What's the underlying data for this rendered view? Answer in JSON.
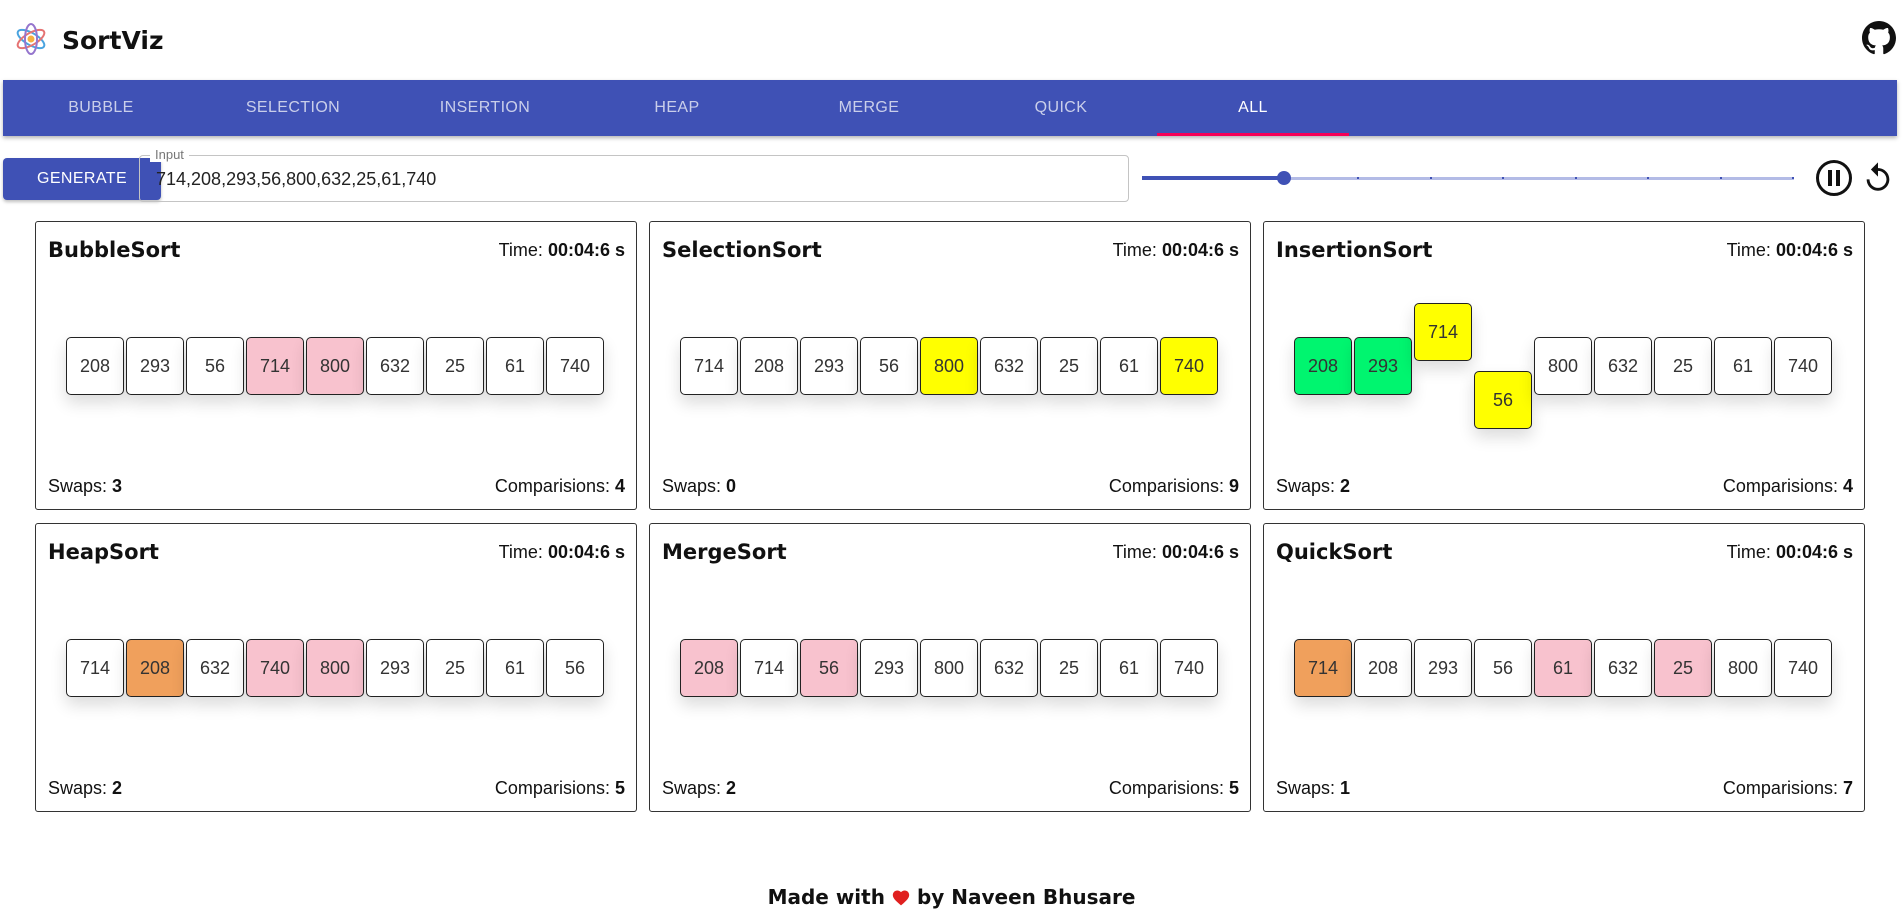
{
  "app": {
    "title": "SortViz"
  },
  "tabs": [
    {
      "label": "BUBBLE",
      "active": false
    },
    {
      "label": "SELECTION",
      "active": false
    },
    {
      "label": "INSERTION",
      "active": false
    },
    {
      "label": "HEAP",
      "active": false
    },
    {
      "label": "MERGE",
      "active": false
    },
    {
      "label": "QUICK",
      "active": false
    },
    {
      "label": "ALL",
      "active": true
    }
  ],
  "controls": {
    "generate_label": "GENERATE",
    "input_label": "Input",
    "input_value": "714,208,293,56,800,632,25,61,740",
    "speed_slider": {
      "step": 2,
      "steps": 10
    }
  },
  "labels": {
    "time": "Time:",
    "swaps": "Swaps:",
    "comparisons": "Comparisions:"
  },
  "cards": [
    {
      "name": "BubbleSort",
      "time": "00:04:6 s",
      "swaps": "3",
      "comparisons": "4",
      "cells": [
        {
          "value": "208",
          "color": ""
        },
        {
          "value": "293",
          "color": ""
        },
        {
          "value": "56",
          "color": ""
        },
        {
          "value": "714",
          "color": "pink"
        },
        {
          "value": "800",
          "color": "pink"
        },
        {
          "value": "632",
          "color": ""
        },
        {
          "value": "25",
          "color": ""
        },
        {
          "value": "61",
          "color": ""
        },
        {
          "value": "740",
          "color": ""
        }
      ]
    },
    {
      "name": "SelectionSort",
      "time": "00:04:6 s",
      "swaps": "0",
      "comparisons": "9",
      "cells": [
        {
          "value": "714",
          "color": ""
        },
        {
          "value": "208",
          "color": ""
        },
        {
          "value": "293",
          "color": ""
        },
        {
          "value": "56",
          "color": ""
        },
        {
          "value": "800",
          "color": "yellow"
        },
        {
          "value": "632",
          "color": ""
        },
        {
          "value": "25",
          "color": ""
        },
        {
          "value": "61",
          "color": ""
        },
        {
          "value": "740",
          "color": "yellow"
        }
      ]
    },
    {
      "name": "InsertionSort",
      "time": "00:04:6 s",
      "swaps": "2",
      "comparisons": "4",
      "cells": [
        {
          "value": "208",
          "color": "green",
          "offset": "mid"
        },
        {
          "value": "293",
          "color": "green",
          "offset": "mid"
        },
        {
          "value": "714",
          "color": "yellow",
          "offset": "up"
        },
        {
          "value": "56",
          "color": "yellow",
          "offset": "down"
        },
        {
          "value": "800",
          "color": "",
          "offset": "mid"
        },
        {
          "value": "632",
          "color": "",
          "offset": "mid"
        },
        {
          "value": "25",
          "color": "",
          "offset": "mid"
        },
        {
          "value": "61",
          "color": "",
          "offset": "mid"
        },
        {
          "value": "740",
          "color": "",
          "offset": "mid"
        }
      ]
    },
    {
      "name": "HeapSort",
      "time": "00:04:6 s",
      "swaps": "2",
      "comparisons": "5",
      "cells": [
        {
          "value": "714",
          "color": ""
        },
        {
          "value": "208",
          "color": "orange"
        },
        {
          "value": "632",
          "color": ""
        },
        {
          "value": "740",
          "color": "pink"
        },
        {
          "value": "800",
          "color": "pink"
        },
        {
          "value": "293",
          "color": ""
        },
        {
          "value": "25",
          "color": ""
        },
        {
          "value": "61",
          "color": ""
        },
        {
          "value": "56",
          "color": ""
        }
      ]
    },
    {
      "name": "MergeSort",
      "time": "00:04:6 s",
      "swaps": "2",
      "comparisons": "5",
      "cells": [
        {
          "value": "208",
          "color": "pink"
        },
        {
          "value": "714",
          "color": ""
        },
        {
          "value": "56",
          "color": "pink"
        },
        {
          "value": "293",
          "color": ""
        },
        {
          "value": "800",
          "color": ""
        },
        {
          "value": "632",
          "color": ""
        },
        {
          "value": "25",
          "color": ""
        },
        {
          "value": "61",
          "color": ""
        },
        {
          "value": "740",
          "color": ""
        }
      ]
    },
    {
      "name": "QuickSort",
      "time": "00:04:6 s",
      "swaps": "1",
      "comparisons": "7",
      "cells": [
        {
          "value": "714",
          "color": "orange"
        },
        {
          "value": "208",
          "color": ""
        },
        {
          "value": "293",
          "color": ""
        },
        {
          "value": "56",
          "color": ""
        },
        {
          "value": "61",
          "color": "pink"
        },
        {
          "value": "632",
          "color": ""
        },
        {
          "value": "25",
          "color": "pink"
        },
        {
          "value": "800",
          "color": ""
        },
        {
          "value": "740",
          "color": ""
        }
      ]
    }
  ],
  "footer": {
    "prefix": "Made with",
    "suffix": "by Naveen Bhusare"
  },
  "icons": {
    "logo": "atom-logo-icon",
    "github": "github-icon",
    "pause": "pause-icon",
    "reset": "reset-icon",
    "heart": "heart-icon"
  },
  "colors": {
    "primary": "#3f51b5",
    "indicator": "#f50057",
    "pink": "#f8c2ce",
    "yellow": "#ffff00",
    "green": "#00f56f",
    "orange": "#f0a05c"
  }
}
